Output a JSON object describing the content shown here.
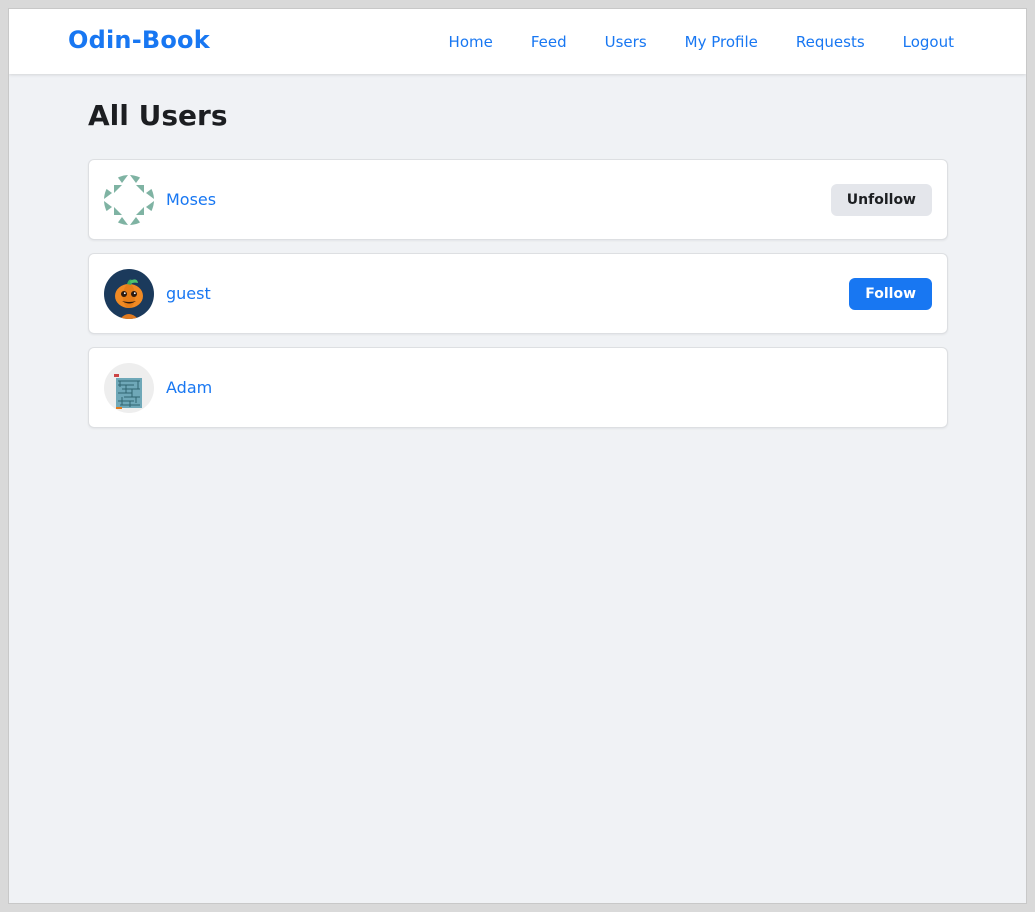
{
  "navbar": {
    "brand": "Odin-Book",
    "links": [
      "Home",
      "Feed",
      "Users",
      "My Profile",
      "Requests",
      "Logout"
    ]
  },
  "page": {
    "title": "All Users"
  },
  "users": [
    {
      "name": "Moses",
      "avatar": "identicon-avatar",
      "action": "Unfollow"
    },
    {
      "name": "guest",
      "avatar": "pumpkin-avatar",
      "action": "Follow"
    },
    {
      "name": "Adam",
      "avatar": "maze-avatar",
      "action": ""
    }
  ],
  "colors": {
    "accent": "#1877f2",
    "background": "#f0f2f5",
    "card": "#ffffff",
    "secondary_button": "#e4e6eb",
    "text": "#1c1e21"
  }
}
